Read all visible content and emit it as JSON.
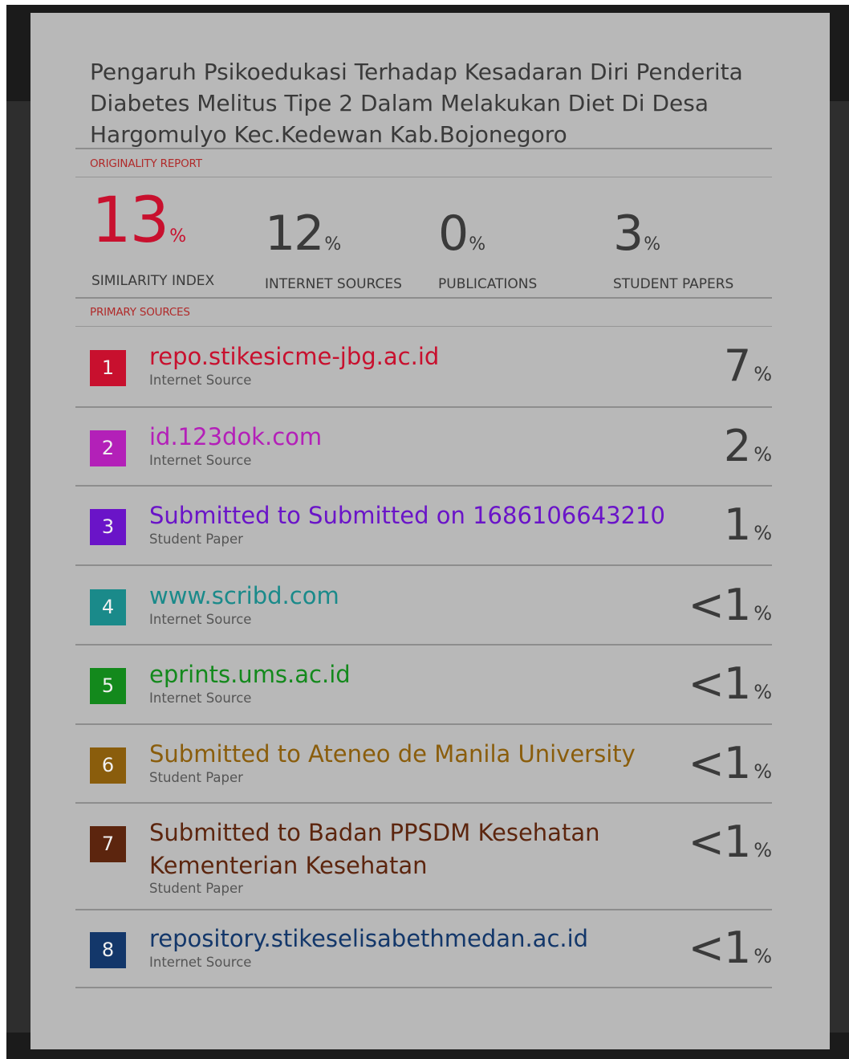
{
  "title": "Pengaruh Psikoedukasi Terhadap Kesadaran Diri Penderita Diabetes Melitus Tipe 2 Dalam Melakukan Diet Di Desa Hargomulyo Kec.Kedewan Kab.Bojonegoro",
  "originality_label": "ORIGINALITY REPORT",
  "primary_label": "PRIMARY SOURCES",
  "stats": [
    {
      "value": "13",
      "unit": "%",
      "label": "SIMILARITY INDEX"
    },
    {
      "value": "12",
      "unit": "%",
      "label": "INTERNET SOURCES"
    },
    {
      "value": "0",
      "unit": "%",
      "label": "PUBLICATIONS"
    },
    {
      "value": "3",
      "unit": "%",
      "label": "STUDENT PAPERS"
    }
  ],
  "sources": [
    {
      "rank": "1",
      "name": "repo.stikesicme-jbg.ac.id",
      "type": "Internet Source",
      "share": "7",
      "unit": "%",
      "color": "#c8102e"
    },
    {
      "rank": "2",
      "name": "id.123dok.com",
      "type": "Internet Source",
      "share": "2",
      "unit": "%",
      "color": "#b320b8"
    },
    {
      "rank": "3",
      "name": "Submitted to Submitted on 1686106643210",
      "type": "Student Paper",
      "share": "1",
      "unit": "%",
      "color": "#6a14c8"
    },
    {
      "rank": "4",
      "name": "www.scribd.com",
      "type": "Internet Source",
      "share": "<1",
      "unit": "%",
      "color": "#1a8a8a"
    },
    {
      "rank": "5",
      "name": "eprints.ums.ac.id",
      "type": "Internet Source",
      "share": "<1",
      "unit": "%",
      "color": "#13891c"
    },
    {
      "rank": "6",
      "name": "Submitted to Ateneo de Manila University",
      "type": "Student Paper",
      "share": "<1",
      "unit": "%",
      "color": "#8a5d0c"
    },
    {
      "rank": "7",
      "name": "Submitted to Badan PPSDM Kesehatan Kementerian Kesehatan",
      "type": "Student Paper",
      "share": "<1",
      "unit": "%",
      "color": "#5c250e"
    },
    {
      "rank": "8",
      "name": "repository.stikeselisabethmedan.ac.id",
      "type": "Internet Source",
      "share": "<1",
      "unit": "%",
      "color": "#13376a"
    }
  ]
}
